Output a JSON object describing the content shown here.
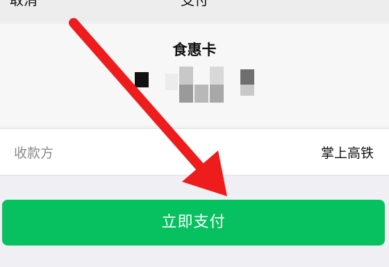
{
  "nav": {
    "cancel_label": "取消",
    "title": "支付"
  },
  "card": {
    "name": "食惠卡",
    "number_icon": "pixelated-card-number"
  },
  "payee": {
    "label": "收款方",
    "value": "掌上高铁"
  },
  "action": {
    "pay_label": "立即支付"
  },
  "overlay": {
    "icon": "red-arrow-icon"
  },
  "colors": {
    "pay_button": "#07c160",
    "arrow": "#ee1c1c",
    "background": "#efeff4"
  }
}
